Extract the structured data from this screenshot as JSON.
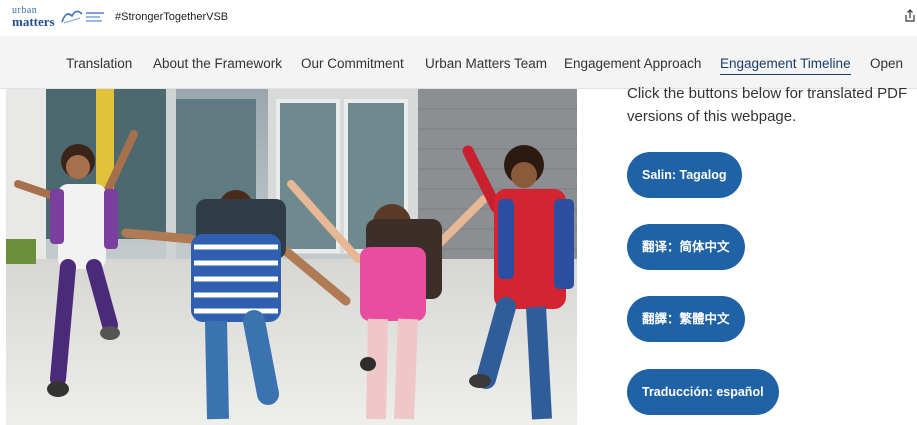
{
  "header": {
    "logo_top": "urban",
    "logo_bottom": "matters",
    "hashtag": "#StrongerTogetherVSB"
  },
  "nav": {
    "items": [
      {
        "label": "Translation"
      },
      {
        "label": "About the Framework"
      },
      {
        "label": "Our Commitment"
      },
      {
        "label": "Urban Matters Team"
      },
      {
        "label": "Engagement Approach"
      },
      {
        "label": "Engagement Timeline",
        "active": true
      },
      {
        "label": "Open"
      }
    ]
  },
  "main": {
    "intro": "Click the buttons below for translated PDF versions of this webpage.",
    "translation_buttons": [
      {
        "label": "Salin: Tagalog"
      },
      {
        "label": "翻译：简体中文"
      },
      {
        "label": "翻譯：繁體中文"
      },
      {
        "label": "Traducción: español"
      }
    ]
  },
  "colors": {
    "button_blue": "#1f63a6",
    "nav_active": "#1a3d6e",
    "nav_background": "#f4f4f4"
  },
  "icons": [
    "share-icon"
  ]
}
